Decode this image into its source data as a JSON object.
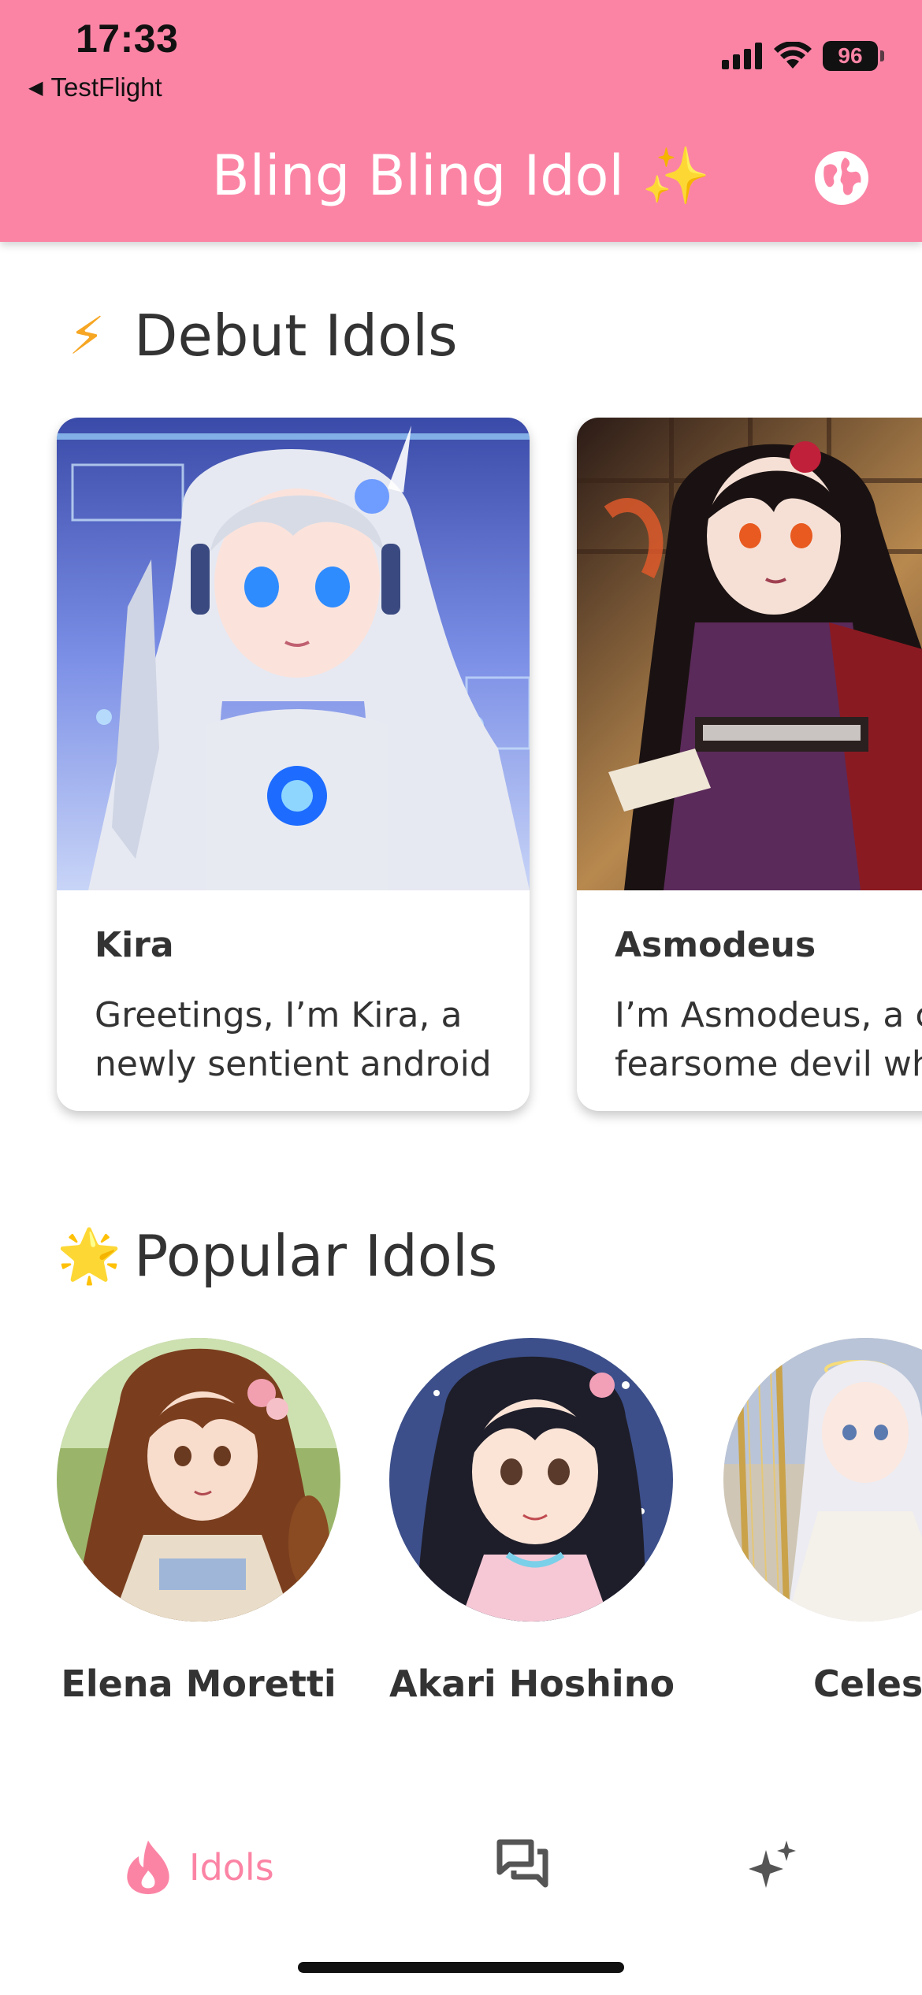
{
  "status_bar": {
    "time": "17:33",
    "back_app": "TestFlight",
    "battery": "96"
  },
  "header": {
    "title": "Bling Bling Idol",
    "title_emoji": "✨",
    "globe_icon": "globe-icon"
  },
  "debut_section": {
    "emoji": "⚡",
    "title": "Debut Idols",
    "cards": [
      {
        "name": "Kira",
        "bio_line1": "Greetings, I’m Kira, a",
        "bio_line2": "newly sentient android"
      },
      {
        "name": "Asmodeus",
        "bio_line1": "I’m Asmodeus, a c",
        "bio_line2": "fearsome devil wh"
      }
    ]
  },
  "popular_section": {
    "emoji": "🌟",
    "title": "Popular Idols",
    "idols": [
      {
        "name": "Elena Moretti"
      },
      {
        "name": "Akari Hoshino"
      },
      {
        "name": "Celest"
      }
    ]
  },
  "tab_bar": {
    "items": [
      {
        "label": "Idols",
        "icon": "flame-icon",
        "active": true
      },
      {
        "label": "",
        "icon": "chat-icon",
        "active": false
      },
      {
        "label": "",
        "icon": "sparkles-icon",
        "active": false
      }
    ]
  },
  "colors": {
    "accent": "#fb84a5",
    "text": "#333333",
    "background": "#ffffff"
  }
}
